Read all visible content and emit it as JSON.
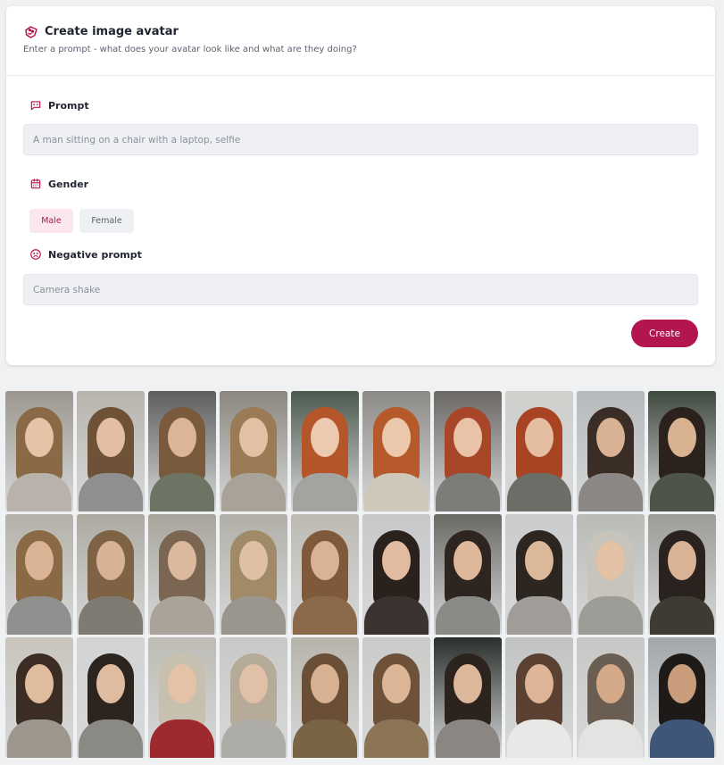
{
  "header": {
    "title": "Create image avatar",
    "subtitle": "Enter a prompt - what does your avatar look like and what are they doing?",
    "icon": "palette-icon"
  },
  "prompt": {
    "label": "Prompt",
    "icon": "chat-bot-icon",
    "placeholder": "A man sitting on a chair with a laptop, selfie",
    "value": ""
  },
  "gender": {
    "label": "Gender",
    "icon": "calendar-icon",
    "options": [
      "Male",
      "Female"
    ],
    "selected": "Male"
  },
  "negative_prompt": {
    "label": "Negative prompt",
    "icon": "sad-face-icon",
    "placeholder": "Camera shake",
    "value": ""
  },
  "actions": {
    "create_label": "Create"
  },
  "colors": {
    "accent": "#b3164e",
    "accent_soft": "#fbe7ed",
    "input_bg": "#eef0f3"
  },
  "gallery": {
    "thumbnails": [
      {
        "hair": "#8a6a46",
        "skin": "#e6c2a6",
        "clothes": "#b9b2ab",
        "bg": "#9c9890"
      },
      {
        "hair": "#6e5238",
        "skin": "#e4bea2",
        "clothes": "#8f8f8f",
        "bg": "#b8b4ad"
      },
      {
        "hair": "#7a5a3c",
        "skin": "#dcb596",
        "clothes": "#6e7463",
        "bg": "#5d5f5e"
      },
      {
        "hair": "#9a7b55",
        "skin": "#e2c0a4",
        "clothes": "#a8a298",
        "bg": "#8b8780"
      },
      {
        "hair": "#b5562a",
        "skin": "#eccab0",
        "clothes": "#a3a3a0",
        "bg": "#4c5a4e"
      },
      {
        "hair": "#b65a2c",
        "skin": "#ebc8ab",
        "clothes": "#cfc7b9",
        "bg": "#8c8a86"
      },
      {
        "hair": "#a8462a",
        "skin": "#e8c3a8",
        "clothes": "#7c7d78",
        "bg": "#6b6865"
      },
      {
        "hair": "#a84424",
        "skin": "#e5bea2",
        "clothes": "#6a6e66",
        "bg": "#cfcfcc"
      },
      {
        "hair": "#3a2d26",
        "skin": "#d8b292",
        "clothes": "#8b8784",
        "bg": "#b5b9bc"
      },
      {
        "hair": "#2b221d",
        "skin": "#d9b292",
        "clothes": "#4e5448",
        "bg": "#3f4a40"
      },
      {
        "hair": "#8a6a46",
        "skin": "#dbb496",
        "clothes": "#8f8f8d",
        "bg": "#b4b1a8"
      },
      {
        "hair": "#7d6244",
        "skin": "#d8b294",
        "clothes": "#7f7a72",
        "bg": "#aca9a0"
      },
      {
        "hair": "#7b6654",
        "skin": "#dcb99c",
        "clothes": "#a9a39a",
        "bg": "#a8a59c"
      },
      {
        "hair": "#a08a68",
        "skin": "#e0c0a5",
        "clothes": "#9a968d",
        "bg": "#b1afa8"
      },
      {
        "hair": "#7e5a3a",
        "skin": "#dab396",
        "clothes": "#8a6a4a",
        "bg": "#bdbab2"
      },
      {
        "hair": "#2a211d",
        "skin": "#e1bca0",
        "clothes": "#3a3330",
        "bg": "#c6c8ca"
      },
      {
        "hair": "#2e2520",
        "skin": "#ddb89a",
        "clothes": "#8a8a87",
        "bg": "#6a6964"
      },
      {
        "hair": "#2d2520",
        "skin": "#dcb89b",
        "clothes": "#a09c97",
        "bg": "#c9cbcc"
      },
      {
        "hair": "#c7c4bb",
        "skin": "#e3c1a4",
        "clothes": "#9d9c96",
        "bg": "#b9bbb6"
      },
      {
        "hair": "#2a221e",
        "skin": "#d9b394",
        "clothes": "#3e3a34",
        "bg": "#9c9c98"
      },
      {
        "hair": "#3b2d24",
        "skin": "#e0bc9f",
        "clothes": "#9c968d",
        "bg": "#c9c5bd"
      },
      {
        "hair": "#2c241f",
        "skin": "#dfbb9f",
        "clothes": "#8b8983",
        "bg": "#d1d3d4"
      },
      {
        "hair": "#c8c0ae",
        "skin": "#e3c2a6",
        "clothes": "#9c2a2e",
        "bg": "#bdbbb4"
      },
      {
        "hair": "#b6ab98",
        "skin": "#e0c0a6",
        "clothes": "#aeaca6",
        "bg": "#c8c9c6"
      },
      {
        "hair": "#6a4e36",
        "skin": "#d8b192",
        "clothes": "#7a6446",
        "bg": "#b7b4ab"
      },
      {
        "hair": "#6e5139",
        "skin": "#dcb697",
        "clothes": "#8c7556",
        "bg": "#cacbc8"
      },
      {
        "hair": "#2c231e",
        "skin": "#dcb799",
        "clothes": "#8a8782",
        "bg": "#2a2f2b"
      },
      {
        "hair": "#5a4131",
        "skin": "#ddb596",
        "clothes": "#e8e8e6",
        "bg": "#c2c4c3"
      },
      {
        "hair": "#6a5e52",
        "skin": "#d4a988",
        "clothes": "#e3e3e1",
        "bg": "#c7c8c5"
      },
      {
        "hair": "#1e1a18",
        "skin": "#c99d7c",
        "clothes": "#3f5678",
        "bg": "#a3a6aa"
      }
    ]
  }
}
